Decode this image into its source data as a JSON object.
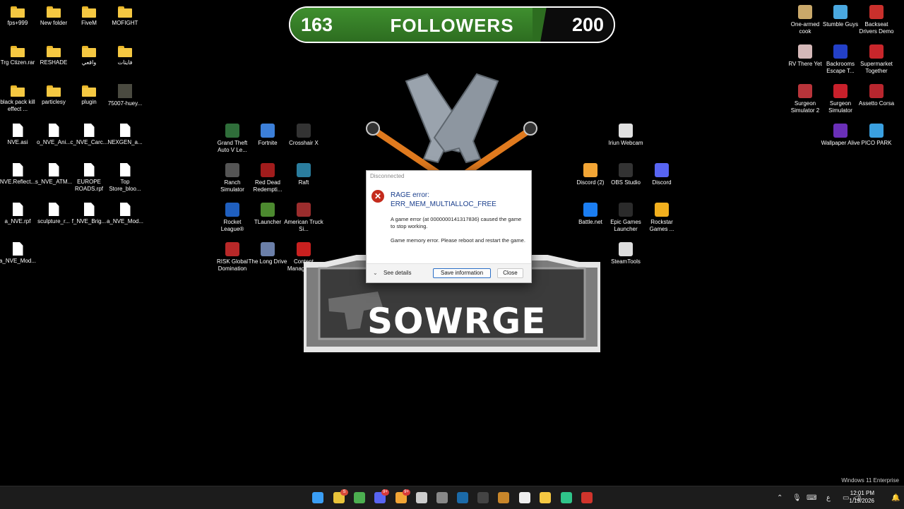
{
  "desktop": {
    "left_icons": [
      {
        "label": "fps+999",
        "kind": "folder"
      },
      {
        "label": "New folder",
        "kind": "folder"
      },
      {
        "label": "FiveM",
        "kind": "folder"
      },
      {
        "label": "MOFIGHT",
        "kind": "folder"
      },
      {
        "label": "Trg Ctizen.rar",
        "kind": "folder"
      },
      {
        "label": "RESHADE",
        "kind": "folder"
      },
      {
        "label": "واقعي",
        "kind": "folder"
      },
      {
        "label": "فايتات",
        "kind": "folder"
      },
      {
        "label": "black pack kill effect ...",
        "kind": "folder"
      },
      {
        "label": "particlesy",
        "kind": "folder"
      },
      {
        "label": "plugin",
        "kind": "folder"
      },
      {
        "label": "75007-huey...",
        "kind": "image"
      },
      {
        "label": "NVE.asi",
        "kind": "file"
      },
      {
        "label": "o_NVE_Ani...",
        "kind": "file"
      },
      {
        "label": "c_NVE_Carc...",
        "kind": "file"
      },
      {
        "label": "NEXGEN_a...",
        "kind": "file"
      },
      {
        "label": "NVE.Reflect...",
        "kind": "file"
      },
      {
        "label": "s_NVE_ATM...",
        "kind": "file"
      },
      {
        "label": "EUROPE ROADS.rpf",
        "kind": "file"
      },
      {
        "label": "Top Store_bloo...",
        "kind": "file"
      },
      {
        "label": "a_NVE.rpf",
        "kind": "file"
      },
      {
        "label": "sculpture_r...",
        "kind": "file"
      },
      {
        "label": "f_NVE_Brig...",
        "kind": "file"
      },
      {
        "label": "a_NVE_Mod...",
        "kind": "file"
      },
      {
        "label": "a_NVE_Mod...",
        "kind": "file"
      }
    ],
    "middle_icons": [
      {
        "label": "Grand Theft Auto V Le...",
        "color": "#2f6e3a"
      },
      {
        "label": "Fortnite",
        "color": "#3c7fd8"
      },
      {
        "label": "Crosshair X",
        "color": "#333333"
      },
      {
        "label": "Ranch Simulator",
        "color": "#555555"
      },
      {
        "label": "Red Dead Redempti...",
        "color": "#a11c1c"
      },
      {
        "label": "Raft",
        "color": "#2a7d9e"
      },
      {
        "label": "Rocket League®",
        "color": "#1f5fbf"
      },
      {
        "label": "TLauncher",
        "color": "#4c8a2f"
      },
      {
        "label": "American Truck Si...",
        "color": "#9b2d2d"
      },
      {
        "label": "RISK Global Domination",
        "color": "#b82828"
      },
      {
        "label": "The Long Drive",
        "color": "#6b7fa8"
      },
      {
        "label": "Content Manager.exe",
        "color": "#c8201f"
      }
    ],
    "center_right_icons": [
      {
        "label": "Iriun Webcam",
        "color": "#e0e0e0"
      },
      {
        "label": "Discord (2)",
        "color": "#f2a535"
      },
      {
        "label": "OBS Studio",
        "color": "#333333"
      },
      {
        "label": "Discord",
        "color": "#5865f2"
      },
      {
        "label": "Battle.net",
        "color": "#1b7ef2"
      },
      {
        "label": "Epic Games Launcher",
        "color": "#2b2b2b"
      },
      {
        "label": "Rockstar Games ...",
        "color": "#f2b01e"
      },
      {
        "label": "SteamTools",
        "color": "#dddddd"
      }
    ],
    "right_icons": [
      {
        "label": "One-armed cook",
        "color": "#c9a86a"
      },
      {
        "label": "Stumble Guys",
        "color": "#4aa8e0"
      },
      {
        "label": "Backseat Drivers Demo",
        "color": "#c9302c"
      },
      {
        "label": "RV There Yet",
        "color": "#d4b8b8"
      },
      {
        "label": "Backrooms Escape T...",
        "color": "#2340c8"
      },
      {
        "label": "Supermarket Together",
        "color": "#c8262b"
      },
      {
        "label": "Surgeon Simulator 2",
        "color": "#b8343a"
      },
      {
        "label": "Surgeon Simulator",
        "color": "#c8202b"
      },
      {
        "label": "Assetto Corsa",
        "color": "#b8262e"
      },
      {
        "label": "Wallpaper Alive",
        "color": "#6a2fb8"
      },
      {
        "label": "PICO PARK",
        "color": "#3aa0e0"
      }
    ]
  },
  "banner": {
    "current": "163",
    "title": "FOLLOWERS",
    "goal": "200",
    "progress_fraction": 0.815
  },
  "wallpaper": {
    "text": "SOWRGE"
  },
  "dialog": {
    "window_title": "Disconnected",
    "heading_line1": "RAGE error:",
    "heading_line2": "ERR_MEM_MULTIALLOC_FREE",
    "message1": "A game error (at 0000000141317836) caused the game to stop working.",
    "message2": "Game memory error. Please reboot and restart the game.",
    "see_details": "See details",
    "save_button": "Save information",
    "close_button": "Close"
  },
  "watermark": "Windows 11 Enterprise",
  "taskbar": {
    "apps": [
      {
        "name": "start-icon",
        "color": "#3a9ef5"
      },
      {
        "name": "chrome-icon",
        "color": "#e8c33a",
        "badge": "S",
        "badge_color": "#d84a3a"
      },
      {
        "name": "chrome-active-icon",
        "color": "#4caf50"
      },
      {
        "name": "discord-taskbar-icon",
        "color": "#5865f2",
        "badge": "9+",
        "badge_color": "#d83a3a"
      },
      {
        "name": "discord-alt-taskbar-icon",
        "color": "#f2a535",
        "badge": "9+",
        "badge_color": "#d83a3a"
      },
      {
        "name": "settings-icon",
        "color": "#cccccc"
      },
      {
        "name": "recorder-icon",
        "color": "#888888"
      },
      {
        "name": "steam-icon",
        "color": "#1b6aa8"
      },
      {
        "name": "epic-icon",
        "color": "#444444"
      },
      {
        "name": "dash-icon",
        "color": "#c8862a"
      },
      {
        "name": "capcut-icon",
        "color": "#eeeeee"
      },
      {
        "name": "file-explorer-icon",
        "color": "#f5c842"
      },
      {
        "name": "app-green-icon",
        "color": "#2fc48a"
      },
      {
        "name": "error-app-icon",
        "color": "#d0342c"
      }
    ],
    "tray_lang": "ع",
    "time": "12:01 PM",
    "date": "1/19/2026"
  }
}
